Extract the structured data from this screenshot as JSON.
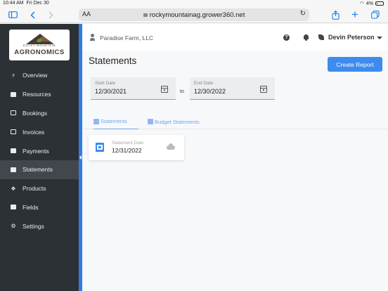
{
  "status_bar": {
    "time": "10:44 AM",
    "date": "Fri Dec 30",
    "battery": "4%"
  },
  "browser": {
    "text_size_label": "AA",
    "url": "rockymountainag.grower360.net"
  },
  "brand": {
    "tagline": "ROCKY MOUNTAIN",
    "name": "AGRONOMICS"
  },
  "sidebar": {
    "items": [
      {
        "label": "Overview",
        "icon": "bolt-icon"
      },
      {
        "label": "Resources",
        "icon": "folder-icon"
      },
      {
        "label": "Bookings",
        "icon": "calendar-icon"
      },
      {
        "label": "Invoices",
        "icon": "invoice-icon"
      },
      {
        "label": "Payments",
        "icon": "payment-icon"
      },
      {
        "label": "Statements",
        "icon": "statements-icon"
      },
      {
        "label": "Products",
        "icon": "dropbox-icon"
      },
      {
        "label": "Fields",
        "icon": "map-icon"
      },
      {
        "label": "Settings",
        "icon": "gear-icon"
      }
    ],
    "active_index": 5
  },
  "header": {
    "account_name": "Paradise Farm, LLC",
    "user_name": "Devin Peterson",
    "help_symbol": "?"
  },
  "page": {
    "title": "Statements",
    "create_button": "Create Report",
    "start_date": {
      "label": "Start Date",
      "value": "12/30/2021"
    },
    "end_date": {
      "label": "End Date",
      "value": "12/30/2022"
    },
    "range_separator": "to",
    "tabs": [
      {
        "label": "Statements",
        "active": true
      },
      {
        "label": "Budget Statements",
        "active": false
      }
    ],
    "statements": [
      {
        "label": "Statement Date",
        "value": "12/31/2022"
      }
    ]
  },
  "colors": {
    "accent": "#3d8bef",
    "sidebar_bg": "#2c3136",
    "divider": "#2f7de0"
  }
}
